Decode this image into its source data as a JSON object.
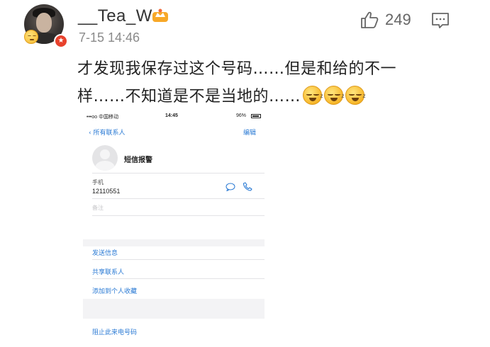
{
  "comment": {
    "username": "__Tea_W",
    "timestamp": "7-15 14:46",
    "like_count": "249",
    "text_line1": "才发现我保存过这个号码……但是和给的不一",
    "text_line2": "样……不知道是不是当地的……",
    "emoji_count": 3,
    "icons": [
      "avatar",
      "sleepy-face-icon",
      "verified-icon",
      "vip-crown-icon",
      "thumbs-up-icon",
      "reply-icon",
      "sleepy-emoji-icon"
    ],
    "colors": {
      "username": "#333333",
      "timestamp": "#8a8a8a",
      "verify_badge": "#e8412c",
      "emoji": "#f7b72a"
    }
  },
  "phone_screen": {
    "status": {
      "carrier": "•••oo 中国移动 ",
      "time": "14:45",
      "battery": "96%"
    },
    "nav": {
      "back_label": "所有联系人",
      "edit_label": "编辑"
    },
    "contact": {
      "name": "短信报警"
    },
    "phone_field": {
      "label": "手机",
      "value": "12110551"
    },
    "notes_label": "备注",
    "actions": {
      "send_message": "发送信息",
      "share_contact": "共享联系人",
      "add_favorites": "添加到个人收藏",
      "block_caller": "阻止此来电号码"
    },
    "colors": {
      "link": "#2a7ad4",
      "section_bg": "#f3f3f5"
    }
  }
}
